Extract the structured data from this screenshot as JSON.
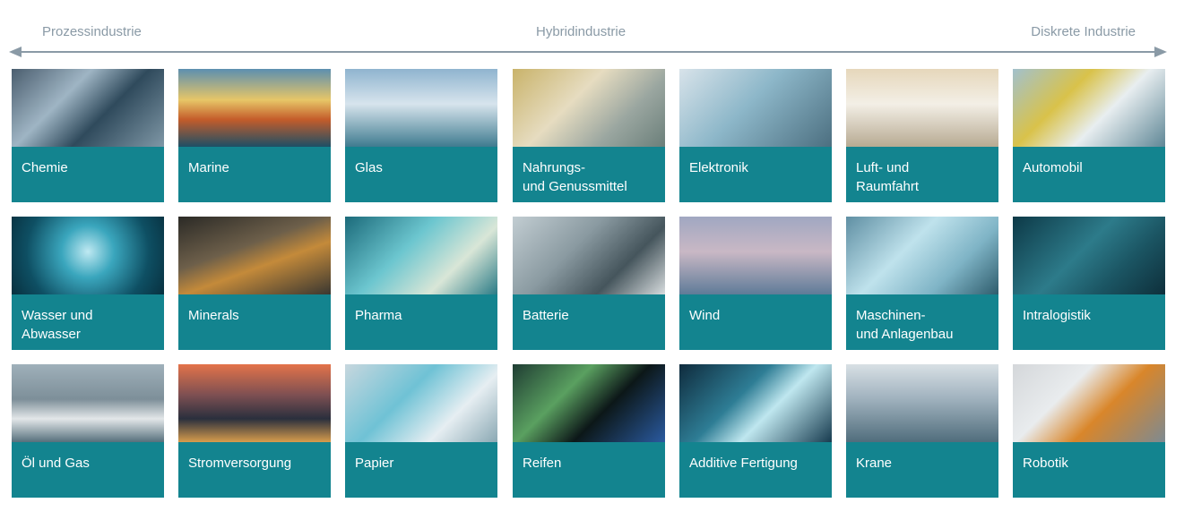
{
  "axis": {
    "left_label": "Prozessindustrie",
    "middle_label": "Hybridindustrie",
    "right_label": "Diskrete Industrie",
    "arrow_color": "#8a9aa6"
  },
  "tiles": [
    {
      "label": "Chemie"
    },
    {
      "label": "Marine"
    },
    {
      "label": "Glas"
    },
    {
      "label": "Nahrungs-\nund Genussmittel"
    },
    {
      "label": "Elektronik"
    },
    {
      "label": "Luft- und\nRaumfahrt"
    },
    {
      "label": "Automobil"
    },
    {
      "label": "Wasser und\nAbwasser"
    },
    {
      "label": "Minerals"
    },
    {
      "label": "Pharma"
    },
    {
      "label": "Batterie"
    },
    {
      "label": "Wind"
    },
    {
      "label": "Maschinen-\nund Anlagenbau"
    },
    {
      "label": "Intralogistik"
    },
    {
      "label": "Öl und Gas"
    },
    {
      "label": "Stromversorgung"
    },
    {
      "label": "Papier"
    },
    {
      "label": "Reifen"
    },
    {
      "label": "Additive Fertigung"
    },
    {
      "label": "Krane"
    },
    {
      "label": "Robotik"
    }
  ],
  "colors": {
    "tile_band": "#108791",
    "label_text": "#ffffff",
    "axis_text": "#8a9aa6"
  }
}
